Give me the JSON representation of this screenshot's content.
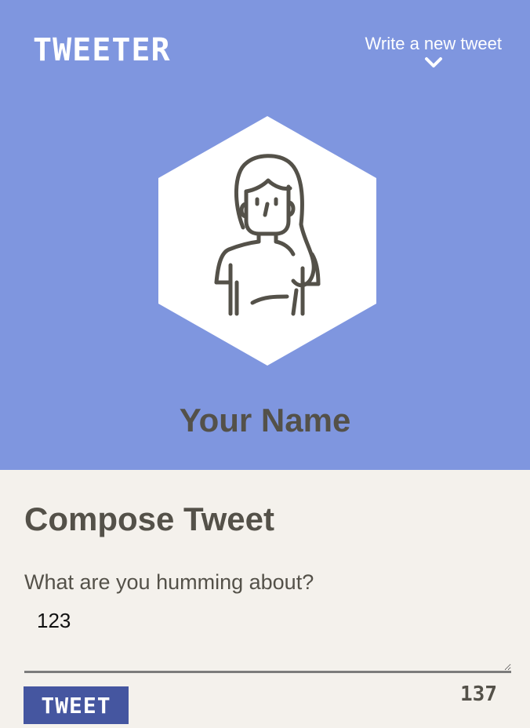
{
  "app": {
    "logo": "TWEETER",
    "new_tweet_link": "Write a new tweet"
  },
  "profile": {
    "avatar_icon": "user-avatar-icon",
    "name": "Your Name"
  },
  "compose": {
    "title": "Compose Tweet",
    "prompt": "What are you humming about?",
    "input_value": "123",
    "button_label": "TWEET",
    "char_counter": "137"
  },
  "colors": {
    "header_bg": "#7f96df",
    "page_bg": "#f4f1ec",
    "button_bg": "#4556a0",
    "text": "#545149"
  },
  "icons": {
    "new_tweet": "chevron-down-icon"
  }
}
